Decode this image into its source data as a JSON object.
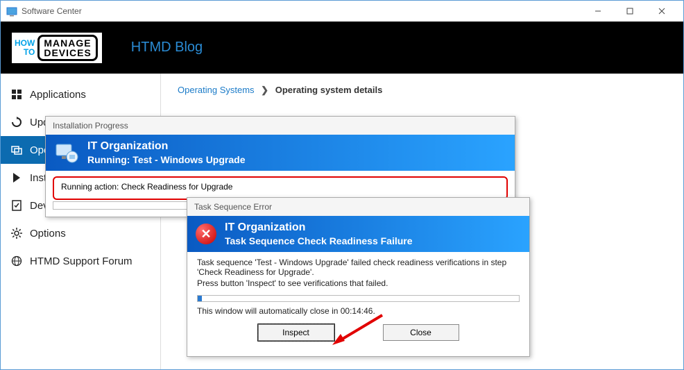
{
  "window": {
    "title": "Software Center"
  },
  "banner": {
    "logo": {
      "how": "HOW",
      "to": "TO",
      "manage": "MANAGE",
      "devices": "DEVICES"
    },
    "title": "HTMD Blog"
  },
  "sidebar": {
    "items": [
      {
        "label": "Applications",
        "icon": "apps"
      },
      {
        "label": "Updates",
        "icon": "updates"
      },
      {
        "label": "Operating Systems",
        "icon": "os"
      },
      {
        "label": "Installation status",
        "icon": "status"
      },
      {
        "label": "Device compliance",
        "icon": "compliance"
      },
      {
        "label": "Options",
        "icon": "gear"
      },
      {
        "label": "HTMD Support Forum",
        "icon": "globe"
      }
    ],
    "active_index": 2
  },
  "breadcrumb": {
    "link": "Operating Systems",
    "current": "Operating system details"
  },
  "progress_dialog": {
    "title": "Installation Progress",
    "org": "IT Organization",
    "subtitle": "Running: Test - Windows Upgrade",
    "running_action": "Running action: Check Readiness for Upgrade"
  },
  "error_dialog": {
    "title": "Task Sequence Error",
    "org": "IT Organization",
    "subtitle": "Task Sequence Check Readiness Failure",
    "message_line1": "Task sequence 'Test - Windows Upgrade' failed check readiness verifications in step 'Check Readiness for Upgrade'.",
    "message_line2": "Press button 'Inspect' to see verifications that failed.",
    "countdown_prefix": "This window will automatically close in ",
    "countdown_time": "00:14:46",
    "countdown_suffix": ".",
    "inspect_label": "Inspect",
    "close_label": "Close"
  }
}
